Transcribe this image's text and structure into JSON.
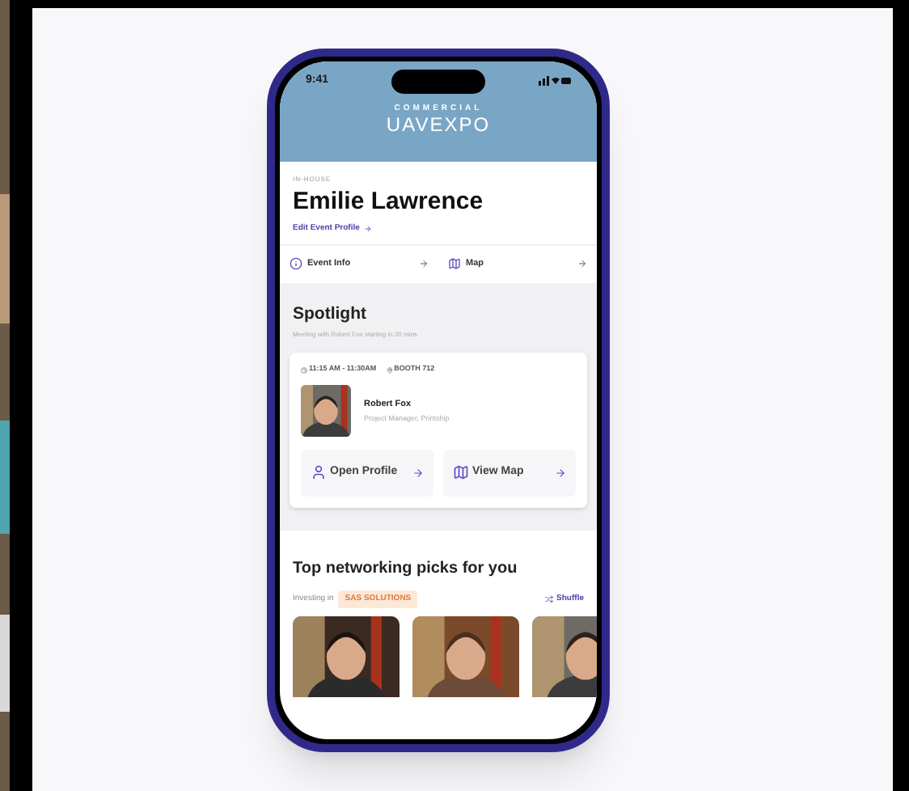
{
  "status_bar": {
    "time": "9:41"
  },
  "logo": {
    "line1": "COMMERCIAL",
    "line2": "UAVEXPO"
  },
  "profile": {
    "label": "IN-HOUSE",
    "name": "Emilie Lawrence",
    "edit_link": "Edit Event Profile"
  },
  "quick_links": [
    {
      "label": "Event Info",
      "kind": "info"
    },
    {
      "label": "Map",
      "kind": "map"
    }
  ],
  "spotlight": {
    "title": "Spotlight",
    "subtitle": "Meeting with Robert Fox starting in 30 mins",
    "time": "11:15 AM - 11:30AM",
    "location": "BOOTH 712",
    "person": {
      "name": "Robert Fox",
      "role": "Project Manager, Printship"
    },
    "actions": [
      {
        "label": "Open Profile",
        "kind": "profile"
      },
      {
        "label": "View Map",
        "kind": "map"
      }
    ]
  },
  "picks": {
    "title": "Top networking picks for you",
    "filter_label": "Investing in",
    "tag": "SAS SOLUTIONS",
    "shuffle": "Shuffle"
  }
}
